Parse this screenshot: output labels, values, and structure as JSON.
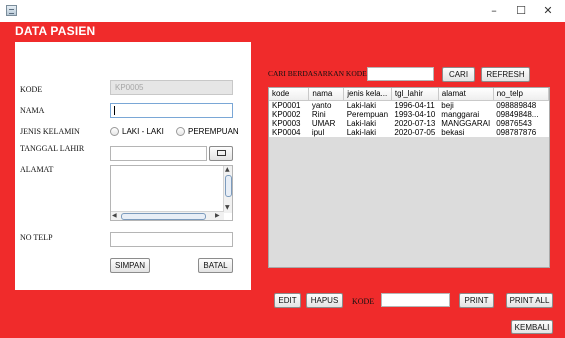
{
  "window": {
    "icon": "java-app-icon",
    "controls": {
      "minimize": "–",
      "maximize": "☐",
      "close": "✕"
    }
  },
  "colors": {
    "background": "#f02b2b",
    "panel": "#ffffff"
  },
  "page_title": "DATA PASIEN",
  "form": {
    "kode_label": "KODE",
    "kode_value": "KP0005",
    "nama_label": "NAMA",
    "nama_value": "",
    "jenis_kelamin_label": "JENIS KELAMIN",
    "gender_options": [
      "LAKI - LAKI",
      "PEREMPUAN"
    ],
    "tanggal_lahir_label": "TANGGAL LAHIR",
    "tanggal_lahir_value": "",
    "alamat_label": "ALAMAT",
    "alamat_value": "",
    "no_telp_label": "NO TELP",
    "no_telp_value": "",
    "simpan_label": "SIMPAN",
    "batal_label": "BATAL"
  },
  "search": {
    "label": "CARI BERDASARKAN KODE",
    "value": "",
    "cari_label": "CARI",
    "refresh_label": "REFRESH"
  },
  "table": {
    "columns": [
      "kode",
      "nama",
      "jenis kela...",
      "tgl_lahir",
      "alamat",
      "no_telp"
    ],
    "rows": [
      [
        "KP0001",
        "yanto",
        "Laki-laki",
        "1996-04-11",
        "beji",
        "098889848"
      ],
      [
        "KP0002",
        "Rini",
        "Perempuan",
        "1993-04-10",
        "manggarai",
        "09849848..."
      ],
      [
        "KP0003",
        "UMAR",
        "Laki-laki",
        "2020-07-13",
        "MANGGARAI",
        "09876543"
      ],
      [
        "KP0004",
        "ipul",
        "Laki-laki",
        "2020-07-05",
        "bekasi",
        "098787876"
      ]
    ]
  },
  "bottom": {
    "edit_label": "EDIT",
    "hapus_label": "HAPUS",
    "kode_label": "KODE",
    "kode_value": "",
    "print_label": "PRINT",
    "print_all_label": "PRINT ALL",
    "kembali_label": "KEMBALI"
  }
}
